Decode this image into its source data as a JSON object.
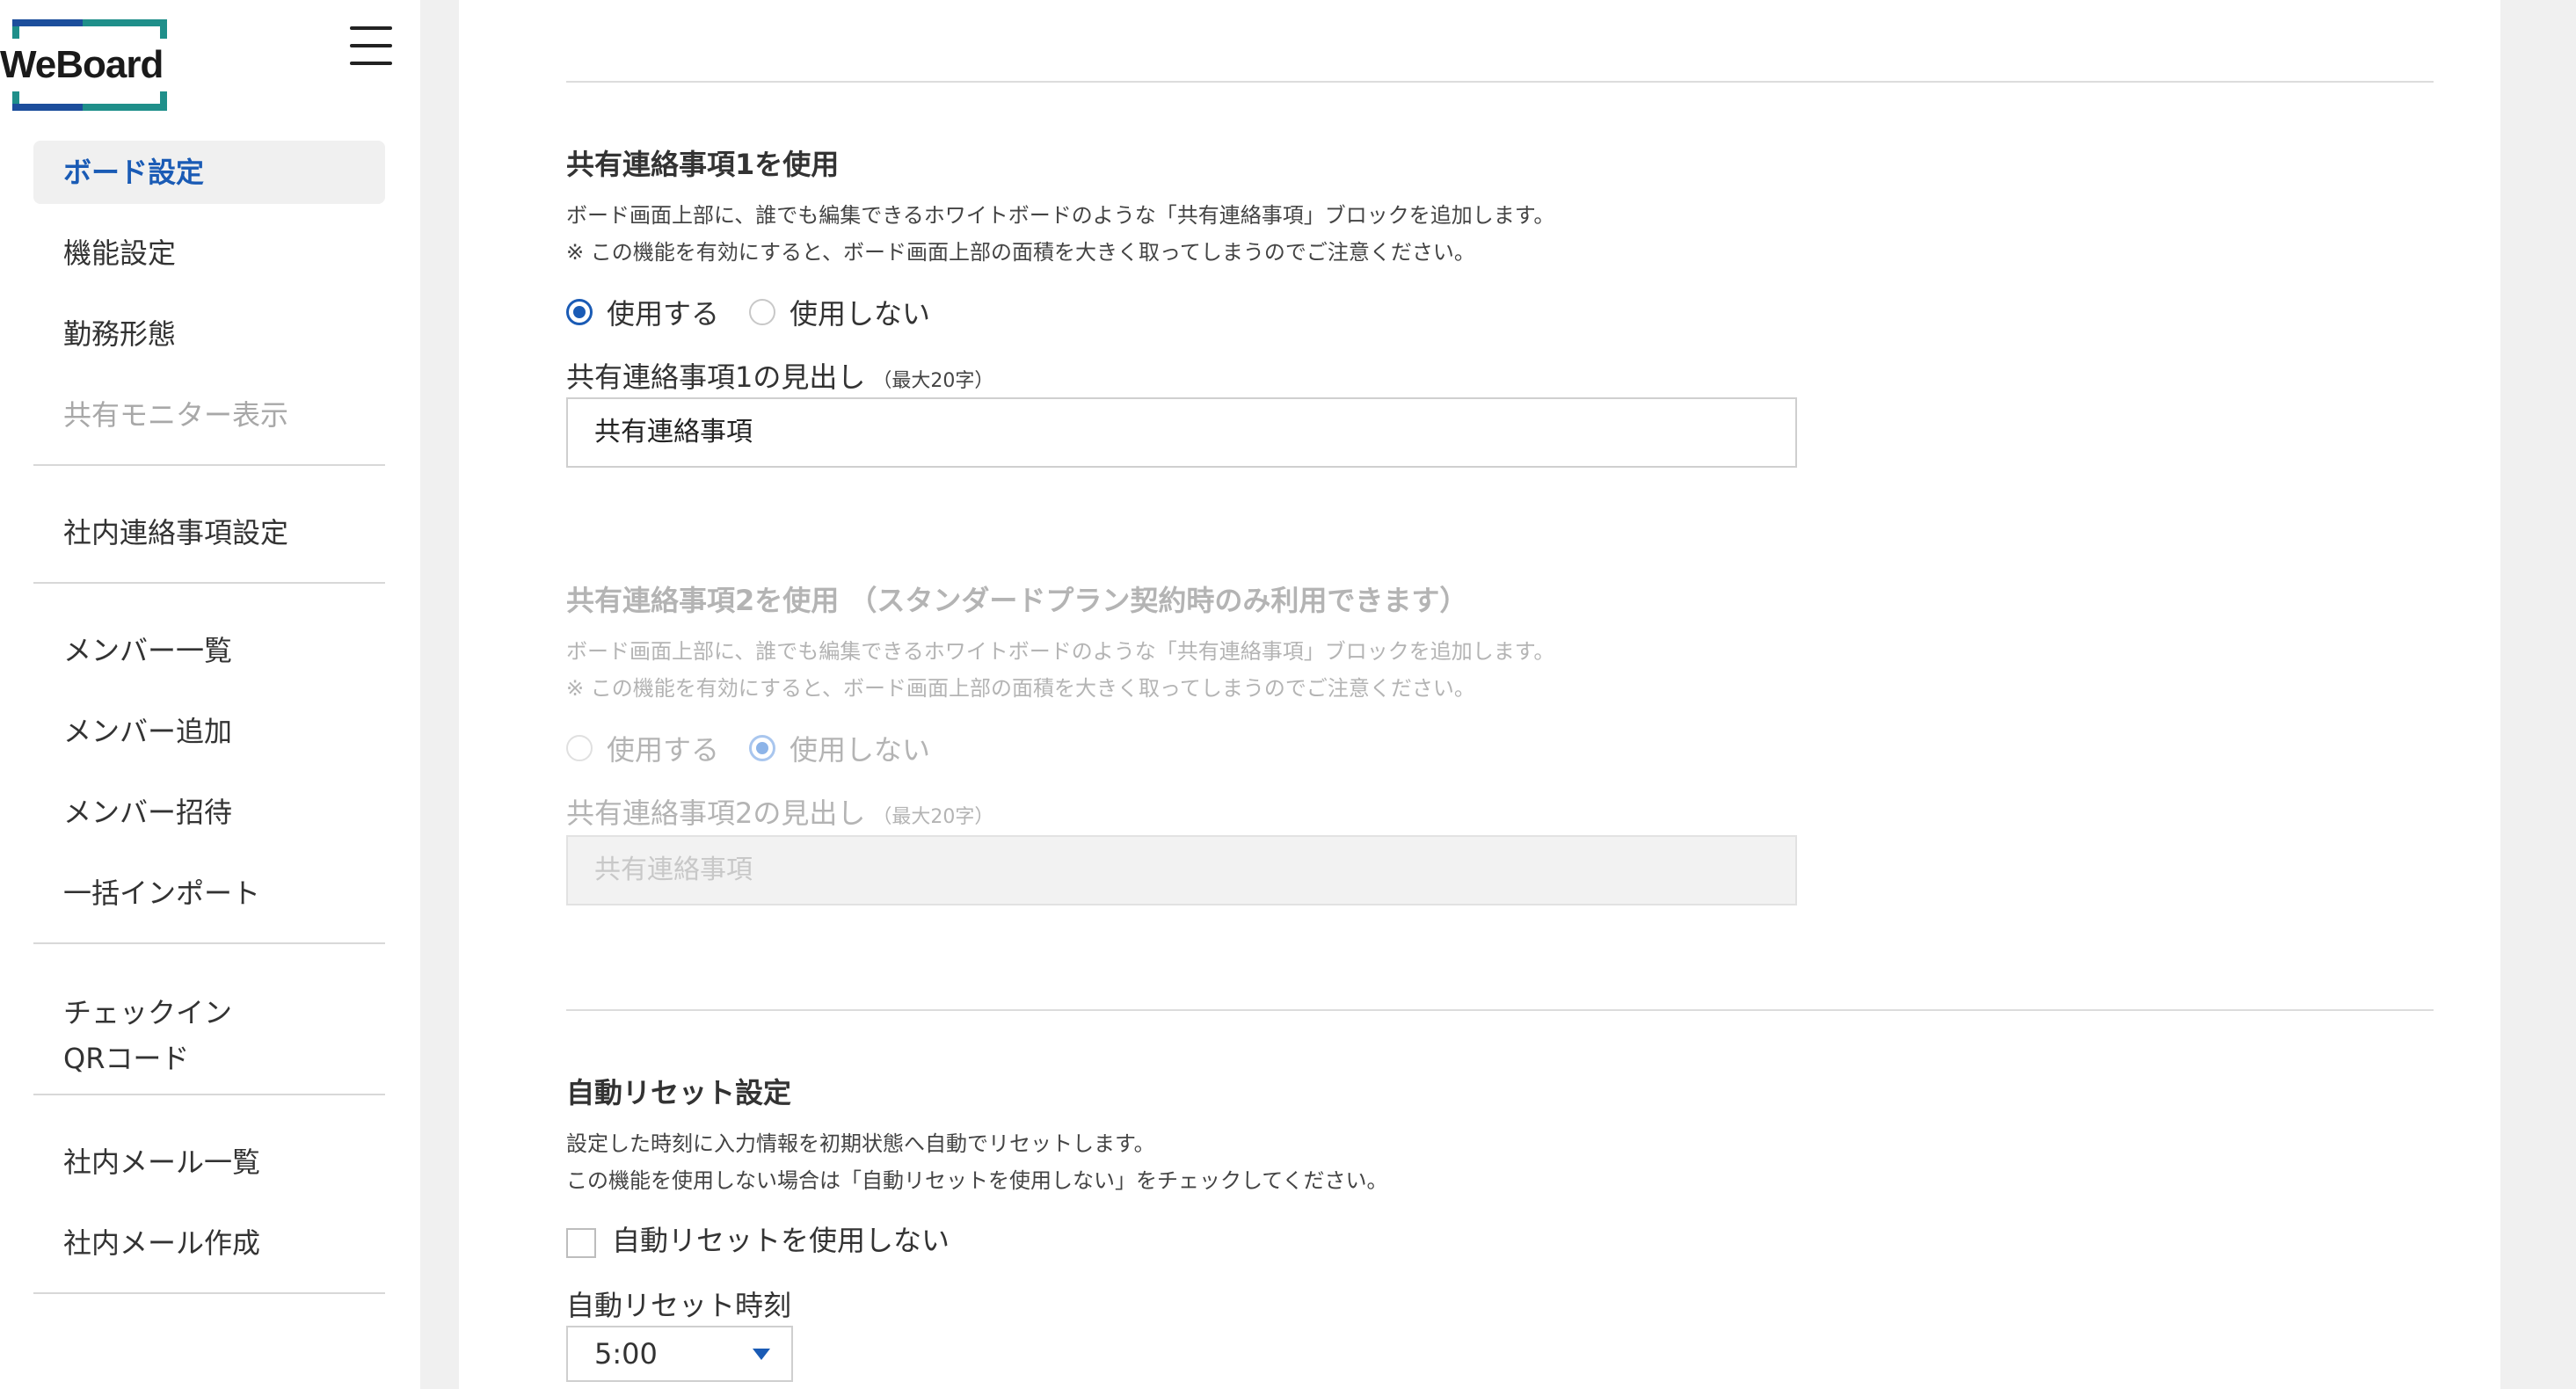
{
  "logo": {
    "text": "WeBoard"
  },
  "sidebar": {
    "groups": [
      [
        {
          "label": "ボード設定",
          "state": "active"
        },
        {
          "label": "機能設定"
        },
        {
          "label": "勤務形態"
        },
        {
          "label": "共有モニター表示",
          "state": "disabled"
        }
      ],
      [
        {
          "label": "社内連絡事項設定"
        }
      ],
      [
        {
          "label": "メンバー一覧"
        },
        {
          "label": "メンバー追加"
        },
        {
          "label": "メンバー招待"
        },
        {
          "label": "一括インポート"
        }
      ],
      [
        {
          "label_line1": "チェックイン",
          "label_line2": "QRコード"
        }
      ],
      [
        {
          "label": "社内メール一覧"
        },
        {
          "label": "社内メール作成"
        }
      ]
    ]
  },
  "section1": {
    "title": "共有連絡事項1を使用",
    "desc1": "ボード画面上部に、誰でも編集できるホワイトボードのような「共有連絡事項」ブロックを追加します。",
    "desc2": "※ この機能を有効にすると、ボード画面上部の面積を大きく取ってしまうのでご注意ください。",
    "radio_use": "使用する",
    "radio_not_use": "使用しない",
    "selected": "use",
    "field_label": "共有連絡事項1の見出し",
    "field_hint": "（最大20字）",
    "field_value": "共有連絡事項"
  },
  "section2": {
    "title": "共有連絡事項2を使用 （スタンダードプラン契約時のみ利用できます）",
    "desc1": "ボード画面上部に、誰でも編集できるホワイトボードのような「共有連絡事項」ブロックを追加します。",
    "desc2": "※ この機能を有効にすると、ボード画面上部の面積を大きく取ってしまうのでご注意ください。",
    "radio_use": "使用する",
    "radio_not_use": "使用しない",
    "selected": "not_use",
    "field_label": "共有連絡事項2の見出し",
    "field_hint": "（最大20字）",
    "field_placeholder": "共有連絡事項",
    "disabled": true
  },
  "section3": {
    "title": "自動リセット設定",
    "desc1": "設定した時刻に入力情報を初期状態へ自動でリセットします。",
    "desc2": "この機能を使用しない場合は「自動リセットを使用しない」をチェックしてください。",
    "checkbox_label": "自動リセットを使用しない",
    "checked": false,
    "time_label": "自動リセット時刻",
    "time_value": "5:00"
  },
  "colors": {
    "accent": "#1a5bb5",
    "logo_teal": "#1f8f8a",
    "logo_blue": "#1c4e9c"
  }
}
